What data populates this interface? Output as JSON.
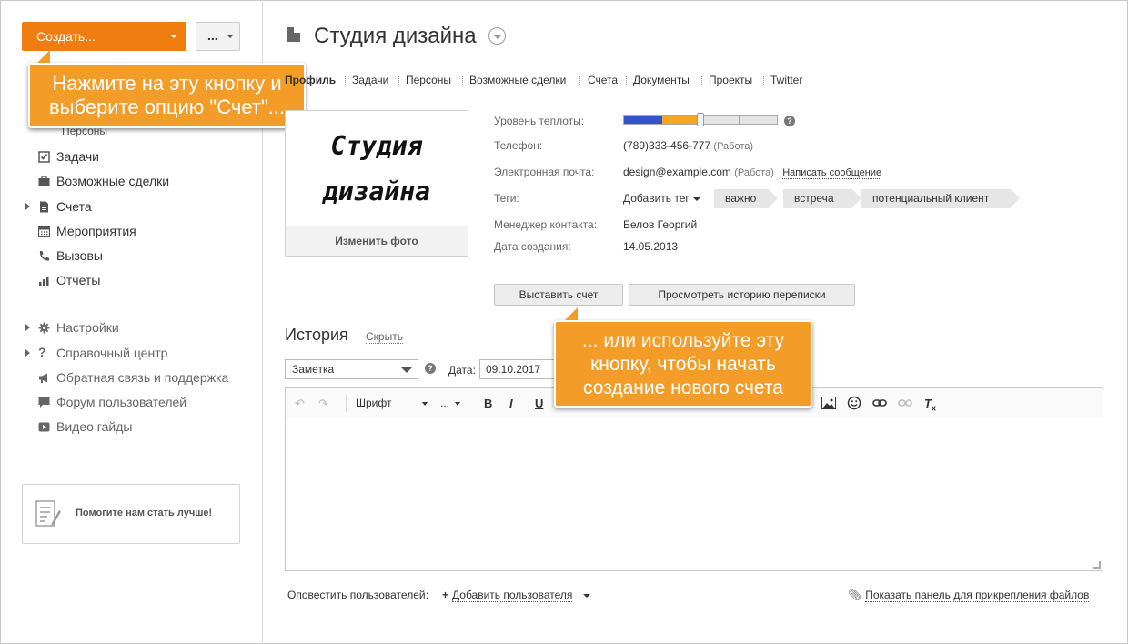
{
  "sidebar": {
    "create_button": "Создать...",
    "more_button": "...",
    "persons_sub": "Персоны",
    "items": [
      {
        "label": "Задачи",
        "icon": "check-square-icon"
      },
      {
        "label": "Возможные сделки",
        "icon": "briefcase-icon"
      },
      {
        "label": "Счета",
        "icon": "document-icon"
      },
      {
        "label": "Мероприятия",
        "icon": "calendar-icon"
      },
      {
        "label": "Вызовы",
        "icon": "phone-icon"
      },
      {
        "label": "Отчеты",
        "icon": "bar-chart-icon"
      }
    ],
    "bottom_items": [
      {
        "label": "Настройки",
        "icon": "gear-icon"
      },
      {
        "label": "Справочный центр",
        "icon": "question-icon"
      },
      {
        "label": "Обратная связь и поддержка",
        "icon": "megaphone-icon"
      },
      {
        "label": "Форум пользователей",
        "icon": "chat-icon"
      },
      {
        "label": "Видео гайды",
        "icon": "play-icon"
      }
    ],
    "feedback_label": "Помогите нам стать лучше!"
  },
  "callouts": {
    "top": "Нажмите на эту кнопку и выберите опцию \"Счет\"...",
    "bottom": "... или используйте эту кнопку, чтобы начать создание нового счета"
  },
  "header": {
    "title": "Студия дизайна"
  },
  "tabs": [
    "Профиль",
    "Задачи",
    "Персоны",
    "Возможные сделки",
    "Счета",
    "Документы",
    "Проекты",
    "Twitter"
  ],
  "photo": {
    "text": "Студия дизайна",
    "change_button": "Изменить фото"
  },
  "info": {
    "warmth_label": "Уровень теплоты:",
    "warmth_level": 0.5,
    "phone_label": "Телефон:",
    "phone_value": "(789)333-456-777",
    "phone_note": "(Работа)",
    "email_label": "Электронная почта:",
    "email_value": "design@example.com",
    "email_note": "(Работа)",
    "email_write": "Написать сообщение",
    "tags_label": "Теги:",
    "tags_add": "Добавить тег",
    "tags": [
      "важно",
      "встреча",
      "потенциальный клиент"
    ],
    "manager_label": "Менеджер контакта:",
    "manager_value": "Белов Георгий",
    "created_label": "Дата создания:",
    "created_value": "14.05.2013"
  },
  "actions": {
    "invoice_button": "Выставить счет",
    "history_button": "Просмотреть историю переписки"
  },
  "history": {
    "title": "История",
    "hide": "Скрыть",
    "type_select": "Заметка",
    "date_label": "Дата:",
    "date_value": "09.10.2017",
    "font_label": "Шрифт",
    "size_label": "..."
  },
  "footer": {
    "notify_label": "Оповестить пользователей:",
    "add_user": "Добавить пользователя",
    "attach_panel": "Показать панель для прикрепления файлов"
  },
  "colors": {
    "accent": "#ef7d10",
    "callout": "#f39c28",
    "heat_blue": "#3355cc",
    "heat_orange": "#f5a623"
  }
}
